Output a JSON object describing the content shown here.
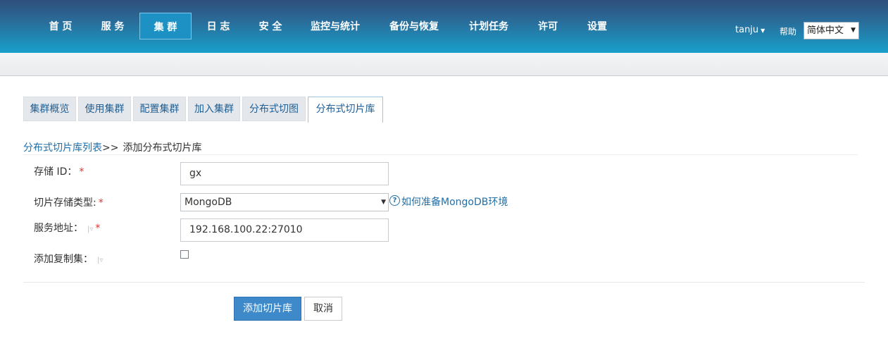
{
  "nav": {
    "items": [
      {
        "label": "首 页"
      },
      {
        "label": "服 务"
      },
      {
        "label": "集 群"
      },
      {
        "label": "日 志"
      },
      {
        "label": "安 全"
      },
      {
        "label": "监控与统计"
      },
      {
        "label": "备份与恢复"
      },
      {
        "label": "计划任务"
      },
      {
        "label": "许可"
      },
      {
        "label": "设置"
      }
    ],
    "active_index": 2,
    "user": "tanju",
    "help": "帮助",
    "language": "简体中文"
  },
  "tabs": [
    {
      "label": "集群概览"
    },
    {
      "label": "使用集群"
    },
    {
      "label": "配置集群"
    },
    {
      "label": "加入集群"
    },
    {
      "label": "分布式切图"
    },
    {
      "label": "分布式切片库"
    }
  ],
  "breadcrumb": {
    "link": "分布式切片库列表",
    "separator": ">>",
    "current": "添加分布式切片库"
  },
  "form": {
    "storage_id": {
      "label": "存储 ID：",
      "required": "*",
      "value": "gx"
    },
    "storage_type": {
      "label": "切片存储类型:",
      "required": "*",
      "value": "MongoDB",
      "help_link": "如何准备MongoDB环境"
    },
    "service_address": {
      "label": "服务地址：",
      "required": "*",
      "value": "192.168.100.22:27010"
    },
    "replica_set": {
      "label": "添加复制集：",
      "checked": false
    }
  },
  "buttons": {
    "submit": "添加切片库",
    "cancel": "取消"
  },
  "colors": {
    "nav_gradient_top": "#2f4f7c",
    "nav_gradient_bottom": "#1a9fcc",
    "link": "#1f6fa8",
    "primary_button": "#3e89c9",
    "required": "#e0322f"
  }
}
